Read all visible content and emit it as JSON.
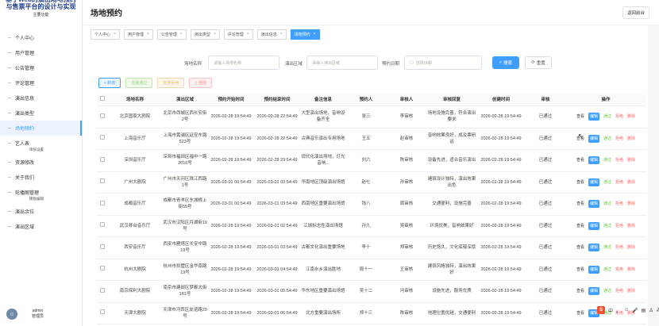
{
  "brand": {
    "title": "基于Web的演出场地预约与售票平台的设计与实现",
    "subtitle": "主要功能"
  },
  "sidebar": {
    "items": [
      {
        "label": "个人中心",
        "active": false
      },
      {
        "label": "用户管理",
        "active": false
      },
      {
        "label": "公告管理",
        "active": false
      },
      {
        "label": "评论管理",
        "active": false
      },
      {
        "label": "演出信息",
        "active": false
      },
      {
        "label": "演出类型",
        "active": false
      },
      {
        "label": "场地预约",
        "active": true
      },
      {
        "label": "艺人表",
        "active": false,
        "sub": "审核设置"
      },
      {
        "label": "资源修改",
        "active": false
      },
      {
        "label": "关于我们",
        "active": false
      },
      {
        "label": "轮播图管理",
        "active": false,
        "sub": "模板编辑"
      },
      {
        "label": "演出余位",
        "active": false
      },
      {
        "label": "演出区域",
        "active": false
      }
    ]
  },
  "user": {
    "name": "admin",
    "role": "管理员"
  },
  "header": {
    "title": "场地预约",
    "back_label": "返回前台"
  },
  "tabs": [
    {
      "label": "个人中心",
      "active": false
    },
    {
      "label": "用户管理",
      "active": false
    },
    {
      "label": "公告管理",
      "active": false
    },
    {
      "label": "演出类型",
      "active": false
    },
    {
      "label": "评论管理",
      "active": false
    },
    {
      "label": "演出信息",
      "active": false
    },
    {
      "label": "场地预约",
      "active": true
    }
  ],
  "search": {
    "venue_label": "场地名称",
    "venue_placeholder": "请输入场地名称",
    "area_label": "演出区域",
    "area_placeholder": "请输入演出区域",
    "date_label": "预约日期",
    "date_placeholder": "选择日期",
    "search_button": "搜索",
    "reset_button": "重置"
  },
  "actions": {
    "add": "+ 新增",
    "approve": "批量通过",
    "reject": "批量拒绝",
    "delete": "删除"
  },
  "table": {
    "headers": [
      "场地名称",
      "演出区域",
      "预约开始时间",
      "预约结束时间",
      "备注信息",
      "预约人",
      "审核人",
      "审核回复",
      "创建时间",
      "审核",
      "操作"
    ],
    "op_labels": {
      "view": "查看",
      "edit": "编辑",
      "pass": "通过",
      "reject": "拒绝",
      "delete": "删除"
    },
    "rows": [
      [
        "北京国家大剧院",
        "北京市西城区西长安街2号",
        "2026-02-28 19:54:49",
        "2026-02-28 22:54:49",
        "大型演出场地，音响设备齐全",
        "张三",
        "李审核",
        "场地设施完善，符合演出要求",
        "2026-02-28 19:54:49",
        "已通过"
      ],
      [
        "上海音乐厅",
        "上海市黄浦区延安东路523号",
        "2026-02-28 19:54:49",
        "2026-02-28 22:54:49",
        "古典音乐演出专用场地",
        "王五",
        "赵审核",
        "音响效果良好，成及票研话",
        "2026-02-28 19:54:49",
        "已通过"
      ],
      [
        "深圳音乐厅",
        "深圳市福田区福中一路2016号",
        "2026-02-28 19:54:49",
        "2026-02-28 23:54:49",
        "现代化演出场地，灯光音响...",
        "刘六",
        "陈审核",
        "设备先进，适合音乐演出",
        "2026-02-28 19:54:49",
        "已通过"
      ],
      [
        "广州大剧院",
        "广州市天河区珠江西路1号",
        "2026-03-01 00:54:49",
        "2026-03-01 03:54:49",
        "华南地区顶级演出场馆",
        "赵七",
        "孙审核",
        "建筑设计独特，演出效果出色",
        "2026-02-28 19:54:49",
        "已通过"
      ],
      [
        "成都音乐厅",
        "成都市青羊区东城根上街55号",
        "2026-03-01 00:54:49",
        "2026-03-01 03:54:49",
        "西南地区重要演出场馆",
        "钱八",
        "周审核",
        "交通便利，设施完善",
        "2026-02-28 19:54:49",
        "已通过"
      ],
      [
        "武汉琴台音乐厅",
        "武汉市汉阳区月湖街19号",
        "2026-02-28 19:54:49",
        "2026-03-01 02:54:49",
        "江城标志性演出场馆",
        "孙九",
        "吴审核",
        "环境优美，音响效果好",
        "2026-02-28 19:54:49",
        "已通过"
      ],
      [
        "西安音乐厅",
        "西安市雁塔区长安中路19号",
        "2026-02-28 19:54:49",
        "2026-03-01 03:54:49",
        "古都文化演出重要场地",
        "李十",
        "郑审核",
        "历史悠久，文化底蕴深厚",
        "2026-02-28 19:54:49",
        "已通过"
      ],
      [
        "杭州大剧院",
        "杭州市拱墅区金华南路19号",
        "2026-02-28 19:54:49",
        "2026-03-01 04:54:49",
        "江南水乡演出胜地",
        "周十一",
        "王审核",
        "建筑风格独特，演出效果好",
        "2026-02-28 19:54:49",
        "已通过"
      ],
      [
        "南京保利大剧院",
        "南京市建邺区梦都大街181号",
        "2026-02-28 19:54:49",
        "2026-03-01 05:54:49",
        "华东地区重要演出场馆",
        "吴十二",
        "冯审核",
        "设施先进，服务优质",
        "2026-02-28 19:54:49",
        "已通过"
      ],
      [
        "天津大剧院",
        "天津市河西区友谊路20号",
        "2026-02-28 19:54:49",
        "2026-03-01 06:54:49",
        "北方重要演出场所",
        "郑十三",
        "陈审核",
        "地理位置优越，交通便利",
        "2026-02-28 19:54:49",
        "已通过"
      ]
    ]
  },
  "dock": {
    "items": [
      "中",
      "。",
      "☺",
      "🎤",
      "▤",
      "♙",
      "⁂"
    ]
  }
}
